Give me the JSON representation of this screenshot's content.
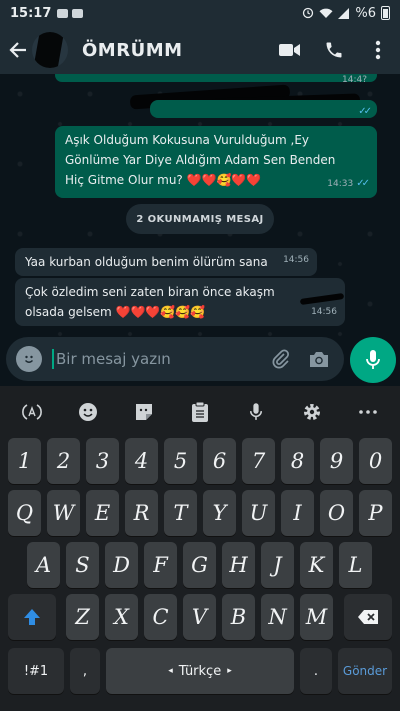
{
  "status_bar": {
    "time": "15:17",
    "battery": "%6"
  },
  "header": {
    "contact_name": "ÖMRÜMM"
  },
  "messages": {
    "outgoing_first_time": "14:4?",
    "outgoing_text": "Aşık Olduğum Kokusuna Vurulduğum ,Ey Gönlüme Yar Diye Aldığım Adam Sen Benden Hiç Gitme Olur mu? ❤️❤️🥰❤️❤️",
    "outgoing_time": "14:33",
    "unread_label": "2 OKUNMAMIŞ MESAJ",
    "incoming_1_text": "Yaa kurban olduğum benim ölürüm sana",
    "incoming_1_time": "14:56",
    "incoming_2_text": "Çok özledim seni zaten biran önce akaşm olsada gelsem ❤️❤️❤️🥰🥰🥰",
    "incoming_2_time": "14:56"
  },
  "composer": {
    "placeholder": "Bir mesaj yazın"
  },
  "keyboard": {
    "numbers": [
      "1",
      "2",
      "3",
      "4",
      "5",
      "6",
      "7",
      "8",
      "9",
      "0"
    ],
    "row1": [
      "Q",
      "W",
      "E",
      "R",
      "T",
      "Y",
      "U",
      "I",
      "O",
      "P"
    ],
    "row2": [
      "A",
      "S",
      "D",
      "F",
      "G",
      "H",
      "J",
      "K",
      "L"
    ],
    "row3": [
      "Z",
      "X",
      "C",
      "V",
      "B",
      "N",
      "M"
    ],
    "symbols_key": "!#1",
    "comma_key": ",",
    "space_label": "Türkçe",
    "period_key": ".",
    "send_key": "Gönder"
  },
  "colors": {
    "accent": "#00a884",
    "outgoing_bubble": "#005c4b",
    "incoming_bubble": "#1f2c34",
    "read_ticks": "#53bdeb",
    "send_key": "#5a9bd8"
  }
}
